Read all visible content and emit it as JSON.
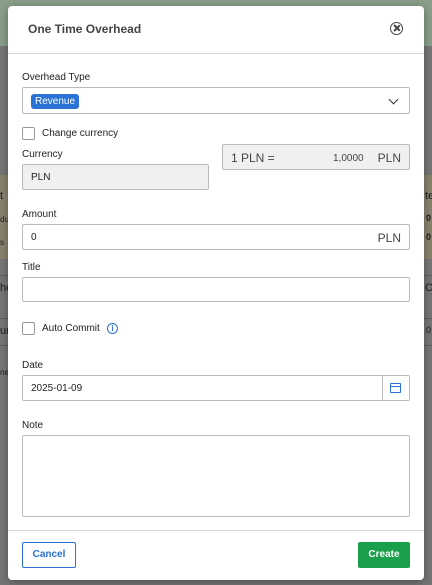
{
  "background": {
    "fragments": [
      "t",
      "du",
      "s",
      "he",
      "ur",
      "ne",
      "te",
      "0",
      "0",
      "Oi",
      "0"
    ]
  },
  "modal": {
    "title": "One Time Overhead",
    "close_icon": "close-circle-icon"
  },
  "form": {
    "overhead_type": {
      "label": "Overhead Type",
      "selected_value": "Revenue"
    },
    "change_currency": {
      "label": "Change currency",
      "checked": false
    },
    "currency": {
      "label": "Currency",
      "value": "PLN"
    },
    "exchange_rate": {
      "prefix": "1 PLN =",
      "value": "1,0000",
      "unit": "PLN"
    },
    "amount": {
      "label": "Amount",
      "value": "0",
      "unit": "PLN"
    },
    "title": {
      "label": "Title",
      "value": ""
    },
    "auto_commit": {
      "label": "Auto Commit",
      "checked": false,
      "info_icon": "info-icon"
    },
    "date": {
      "label": "Date",
      "value": "2025-01-09",
      "calendar_icon": "calendar-icon"
    },
    "note": {
      "label": "Note",
      "value": ""
    }
  },
  "footer": {
    "cancel_label": "Cancel",
    "create_label": "Create"
  },
  "colors": {
    "accent": "#2a72d6",
    "create": "#1aa04a"
  }
}
